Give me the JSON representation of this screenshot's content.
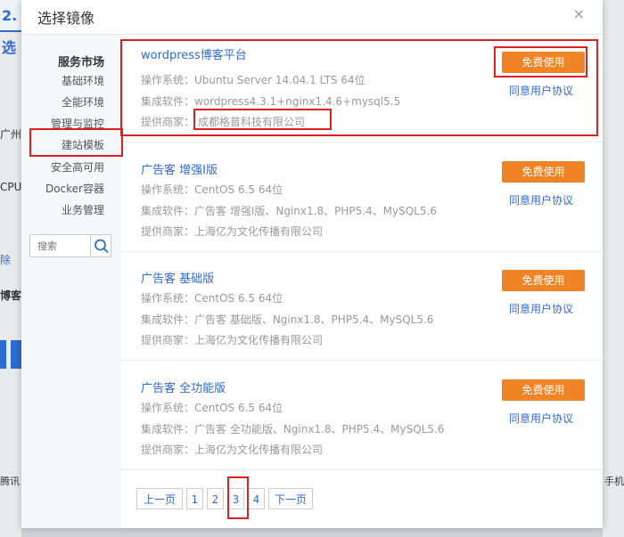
{
  "background": {
    "tab_label": "2.选",
    "frag_1": "广州",
    "frag_2": "CPU",
    "frag_3": "除",
    "frag_4": "博客",
    "frag_5": "腾讯 ",
    "frag_6": "手机"
  },
  "dialog": {
    "title": "选择镜像",
    "close_glyph": "×"
  },
  "sidebar": {
    "heading": "服务市场",
    "items": [
      {
        "label": "基础环境"
      },
      {
        "label": "全能环境"
      },
      {
        "label": "管理与监控"
      },
      {
        "label": "建站模板"
      },
      {
        "label": "安全高可用"
      },
      {
        "label": "Docker容器"
      },
      {
        "label": "业务管理"
      }
    ],
    "active_index": 3,
    "search_placeholder": "搜索"
  },
  "cards": [
    {
      "title": "wordpress博客平台",
      "os_key": "操作系统：",
      "os": "Ubuntu Server 14.04.1 LTS 64位",
      "sw_key": "集成软件：",
      "sw": "wordpress4.3.1+nginx1.4.6+mysql5.5",
      "vendor_key": "提供商家：",
      "vendor": "成都格普科技有限公司",
      "button": "免费使用",
      "agree": "同意用户协议"
    },
    {
      "title": "广告客 增强I版",
      "os_key": "操作系统：",
      "os": "CentOS 6.5 64位",
      "sw_key": "集成软件：",
      "sw": "广告客 增强I版、Nginx1.8、PHP5.4、MySQL5.6",
      "vendor_key": "提供商家：",
      "vendor": "上海亿为文化传播有限公司",
      "button": "免费使用",
      "agree": "同意用户协议"
    },
    {
      "title": "广告客 基础版",
      "os_key": "操作系统：",
      "os": "CentOS 6.5 64位",
      "sw_key": "集成软件：",
      "sw": "广告客 基础版、Nginx1.8、PHP5.4、MySQL5.6",
      "vendor_key": "提供商家：",
      "vendor": "上海亿为文化传播有限公司",
      "button": "免费使用",
      "agree": "同意用户协议"
    },
    {
      "title": "广告客 全功能版",
      "os_key": "操作系统：",
      "os": "CentOS 6.5 64位",
      "sw_key": "集成软件：",
      "sw": "广告客 全功能版、Nginx1.8、PHP5.4、MySQL5.6",
      "vendor_key": "提供商家：",
      "vendor": "上海亿为文化传播有限公司",
      "button": "免费使用",
      "agree": "同意用户协议"
    }
  ],
  "pagination": {
    "prev": "上一页",
    "pages": [
      "1",
      "2",
      "3",
      "4"
    ],
    "next": "下一页"
  },
  "colors": {
    "accent": "#2e6bd1",
    "button": "#f08325",
    "highlight": "#e02020"
  },
  "icons": {
    "search": "search-icon",
    "close": "close-icon"
  }
}
